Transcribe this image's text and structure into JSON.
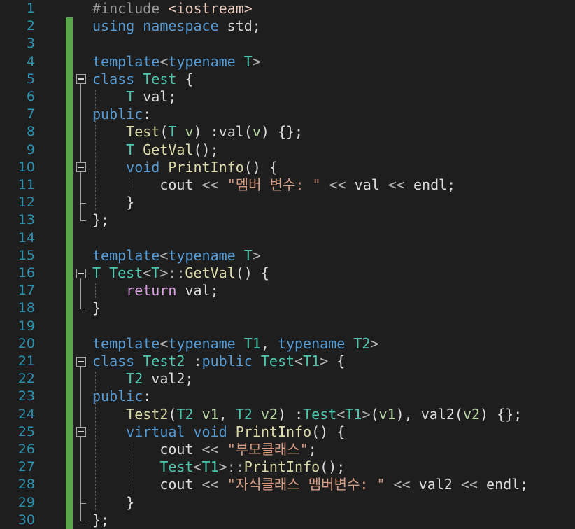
{
  "editor": {
    "line_numbers": [
      "1",
      "2",
      "3",
      "4",
      "5",
      "6",
      "7",
      "8",
      "9",
      "10",
      "11",
      "12",
      "13",
      "14",
      "15",
      "16",
      "17",
      "18",
      "19",
      "20",
      "21",
      "22",
      "23",
      "24",
      "25",
      "26",
      "27",
      "28",
      "29",
      "30"
    ],
    "lines": [
      [
        {
          "t": "#include ",
          "c": "pp"
        },
        {
          "t": "<iostream>",
          "c": "inc"
        }
      ],
      [
        {
          "t": "using",
          "c": "kw"
        },
        {
          "t": " ",
          "c": "var"
        },
        {
          "t": "namespace",
          "c": "kw"
        },
        {
          "t": " std;",
          "c": "var"
        }
      ],
      [],
      [
        {
          "t": "template",
          "c": "kw"
        },
        {
          "t": "<",
          "c": "op"
        },
        {
          "t": "typename",
          "c": "kw"
        },
        {
          "t": " ",
          "c": "var"
        },
        {
          "t": "T",
          "c": "type"
        },
        {
          "t": ">",
          "c": "op"
        }
      ],
      [
        {
          "t": "class",
          "c": "kw"
        },
        {
          "t": " ",
          "c": "var"
        },
        {
          "t": "Test",
          "c": "type"
        },
        {
          "t": " {",
          "c": "var"
        }
      ],
      [
        {
          "t": "    ",
          "c": "var"
        },
        {
          "t": "T",
          "c": "type"
        },
        {
          "t": " val;",
          "c": "var"
        }
      ],
      [
        {
          "t": "public",
          "c": "kw"
        },
        {
          "t": ":",
          "c": "var"
        }
      ],
      [
        {
          "t": "    ",
          "c": "var"
        },
        {
          "t": "Test",
          "c": "fn"
        },
        {
          "t": "(",
          "c": "var"
        },
        {
          "t": "T",
          "c": "type"
        },
        {
          "t": " ",
          "c": "var"
        },
        {
          "t": "v",
          "c": "tp"
        },
        {
          "t": ") :val(",
          "c": "var"
        },
        {
          "t": "v",
          "c": "tp"
        },
        {
          "t": ") {};",
          "c": "var"
        }
      ],
      [
        {
          "t": "    ",
          "c": "var"
        },
        {
          "t": "T",
          "c": "type"
        },
        {
          "t": " ",
          "c": "var"
        },
        {
          "t": "GetVal",
          "c": "fn"
        },
        {
          "t": "();",
          "c": "var"
        }
      ],
      [
        {
          "t": "    ",
          "c": "var"
        },
        {
          "t": "void",
          "c": "kw"
        },
        {
          "t": " ",
          "c": "var"
        },
        {
          "t": "PrintInfo",
          "c": "fn"
        },
        {
          "t": "() {",
          "c": "var"
        }
      ],
      [
        {
          "t": "        cout ",
          "c": "var"
        },
        {
          "t": "<<",
          "c": "op"
        },
        {
          "t": " ",
          "c": "var"
        },
        {
          "t": "\"멤버 변수: \"",
          "c": "str"
        },
        {
          "t": " ",
          "c": "var"
        },
        {
          "t": "<<",
          "c": "op"
        },
        {
          "t": " val ",
          "c": "var"
        },
        {
          "t": "<<",
          "c": "op"
        },
        {
          "t": " endl;",
          "c": "var"
        }
      ],
      [
        {
          "t": "    }",
          "c": "var"
        }
      ],
      [
        {
          "t": "};",
          "c": "var"
        }
      ],
      [],
      [
        {
          "t": "template",
          "c": "kw"
        },
        {
          "t": "<",
          "c": "op"
        },
        {
          "t": "typename",
          "c": "kw"
        },
        {
          "t": " ",
          "c": "var"
        },
        {
          "t": "T",
          "c": "type"
        },
        {
          "t": ">",
          "c": "op"
        }
      ],
      [
        {
          "t": "T",
          "c": "type"
        },
        {
          "t": " ",
          "c": "var"
        },
        {
          "t": "Test",
          "c": "type"
        },
        {
          "t": "<",
          "c": "op"
        },
        {
          "t": "T",
          "c": "type"
        },
        {
          "t": ">",
          "c": "op"
        },
        {
          "t": "::",
          "c": "op"
        },
        {
          "t": "GetVal",
          "c": "fn"
        },
        {
          "t": "() {",
          "c": "var"
        }
      ],
      [
        {
          "t": "    ",
          "c": "var"
        },
        {
          "t": "return",
          "c": "ctl"
        },
        {
          "t": " val;",
          "c": "var"
        }
      ],
      [
        {
          "t": "}",
          "c": "var"
        }
      ],
      [],
      [
        {
          "t": "template",
          "c": "kw"
        },
        {
          "t": "<",
          "c": "op"
        },
        {
          "t": "typename",
          "c": "kw"
        },
        {
          "t": " ",
          "c": "var"
        },
        {
          "t": "T1",
          "c": "type"
        },
        {
          "t": ", ",
          "c": "var"
        },
        {
          "t": "typename",
          "c": "kw"
        },
        {
          "t": " ",
          "c": "var"
        },
        {
          "t": "T2",
          "c": "type"
        },
        {
          "t": ">",
          "c": "op"
        }
      ],
      [
        {
          "t": "class",
          "c": "kw"
        },
        {
          "t": " ",
          "c": "var"
        },
        {
          "t": "Test2",
          "c": "type"
        },
        {
          "t": " :",
          "c": "var"
        },
        {
          "t": "public",
          "c": "kw"
        },
        {
          "t": " ",
          "c": "var"
        },
        {
          "t": "Test",
          "c": "type"
        },
        {
          "t": "<",
          "c": "op"
        },
        {
          "t": "T1",
          "c": "type"
        },
        {
          "t": ">",
          "c": "op"
        },
        {
          "t": " {",
          "c": "var"
        }
      ],
      [
        {
          "t": "    ",
          "c": "var"
        },
        {
          "t": "T2",
          "c": "type"
        },
        {
          "t": " val2;",
          "c": "var"
        }
      ],
      [
        {
          "t": "public",
          "c": "kw"
        },
        {
          "t": ":",
          "c": "var"
        }
      ],
      [
        {
          "t": "    ",
          "c": "var"
        },
        {
          "t": "Test2",
          "c": "fn"
        },
        {
          "t": "(",
          "c": "var"
        },
        {
          "t": "T2",
          "c": "type"
        },
        {
          "t": " ",
          "c": "var"
        },
        {
          "t": "v1",
          "c": "tp"
        },
        {
          "t": ", ",
          "c": "var"
        },
        {
          "t": "T2",
          "c": "type"
        },
        {
          "t": " ",
          "c": "var"
        },
        {
          "t": "v2",
          "c": "tp"
        },
        {
          "t": ") :",
          "c": "var"
        },
        {
          "t": "Test",
          "c": "type"
        },
        {
          "t": "<",
          "c": "op"
        },
        {
          "t": "T1",
          "c": "type"
        },
        {
          "t": ">",
          "c": "op"
        },
        {
          "t": "(",
          "c": "var"
        },
        {
          "t": "v1",
          "c": "tp"
        },
        {
          "t": "), val2(",
          "c": "var"
        },
        {
          "t": "v2",
          "c": "tp"
        },
        {
          "t": ") {};",
          "c": "var"
        }
      ],
      [
        {
          "t": "    ",
          "c": "var"
        },
        {
          "t": "virtual",
          "c": "kw"
        },
        {
          "t": " ",
          "c": "var"
        },
        {
          "t": "void",
          "c": "kw"
        },
        {
          "t": " ",
          "c": "var"
        },
        {
          "t": "PrintInfo",
          "c": "fn"
        },
        {
          "t": "() {",
          "c": "var"
        }
      ],
      [
        {
          "t": "        cout ",
          "c": "var"
        },
        {
          "t": "<<",
          "c": "op"
        },
        {
          "t": " ",
          "c": "var"
        },
        {
          "t": "\"부모클래스\"",
          "c": "str"
        },
        {
          "t": ";",
          "c": "var"
        }
      ],
      [
        {
          "t": "        ",
          "c": "var"
        },
        {
          "t": "Test",
          "c": "type"
        },
        {
          "t": "<",
          "c": "op"
        },
        {
          "t": "T1",
          "c": "type"
        },
        {
          "t": ">",
          "c": "op"
        },
        {
          "t": "::",
          "c": "op"
        },
        {
          "t": "PrintInfo",
          "c": "fn"
        },
        {
          "t": "();",
          "c": "var"
        }
      ],
      [
        {
          "t": "        cout ",
          "c": "var"
        },
        {
          "t": "<<",
          "c": "op"
        },
        {
          "t": " ",
          "c": "var"
        },
        {
          "t": "\"자식클래스 멤버변수: \"",
          "c": "str"
        },
        {
          "t": " ",
          "c": "var"
        },
        {
          "t": "<<",
          "c": "op"
        },
        {
          "t": " val2 ",
          "c": "var"
        },
        {
          "t": "<<",
          "c": "op"
        },
        {
          "t": " endl;",
          "c": "var"
        }
      ],
      [
        {
          "t": "    }",
          "c": "var"
        }
      ],
      [
        {
          "t": "};",
          "c": "var"
        }
      ]
    ]
  }
}
